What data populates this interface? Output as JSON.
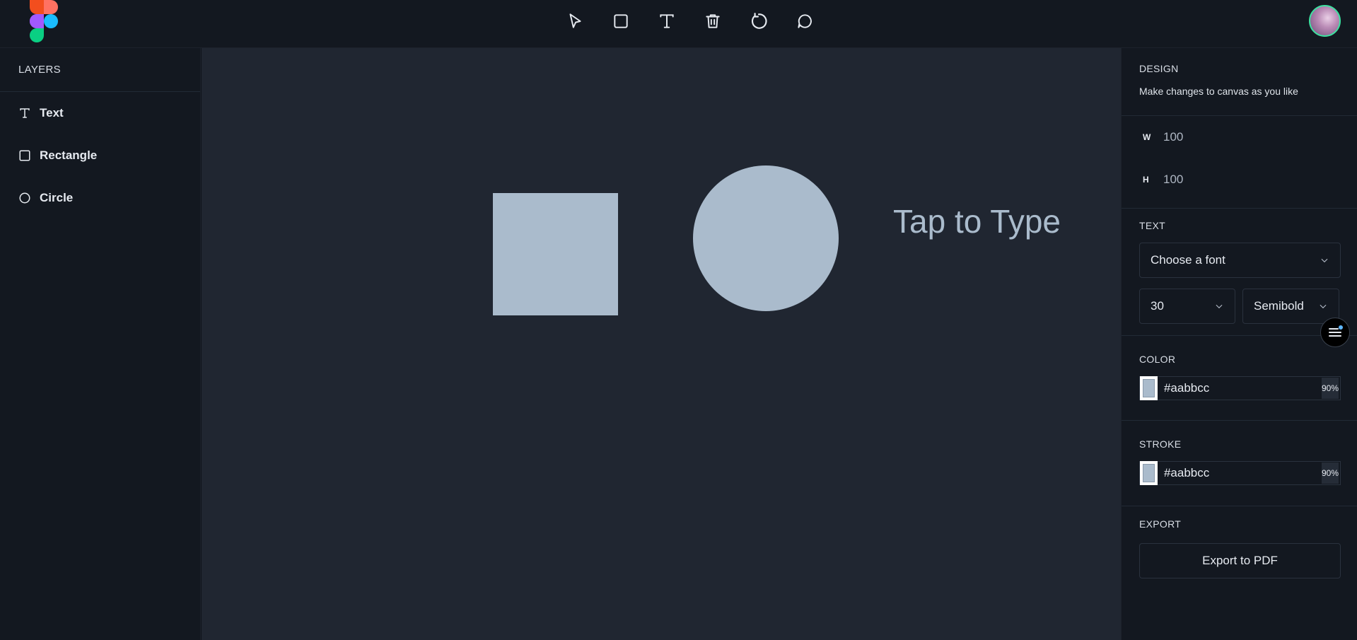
{
  "toolbar": {
    "tools": [
      {
        "name": "select-icon"
      },
      {
        "name": "rectangle-icon"
      },
      {
        "name": "text-icon"
      },
      {
        "name": "trash-icon"
      },
      {
        "name": "reset-icon"
      },
      {
        "name": "comment-icon"
      }
    ]
  },
  "layers": {
    "title": "LAYERS",
    "items": [
      {
        "label": "Text",
        "icon": "text-icon"
      },
      {
        "label": "Rectangle",
        "icon": "rectangle-icon"
      },
      {
        "label": "Circle",
        "icon": "circle-icon"
      }
    ]
  },
  "canvas": {
    "text_object": "Tap to Type",
    "shape_color": "#aabbcc"
  },
  "design": {
    "title": "DESIGN",
    "subtitle": "Make changes to canvas as you like",
    "width_label": "W",
    "width_value": "100",
    "height_label": "H",
    "height_value": "100"
  },
  "text": {
    "title": "TEXT",
    "font_placeholder": "Choose a font",
    "size": "30",
    "weight": "Semibold"
  },
  "color": {
    "title": "COLOR",
    "hex": "#aabbcc",
    "opacity": "90%"
  },
  "stroke": {
    "title": "STROKE",
    "hex": "#aabbcc",
    "opacity": "90%"
  },
  "export": {
    "title": "EXPORT",
    "button_label": "Export to PDF"
  }
}
